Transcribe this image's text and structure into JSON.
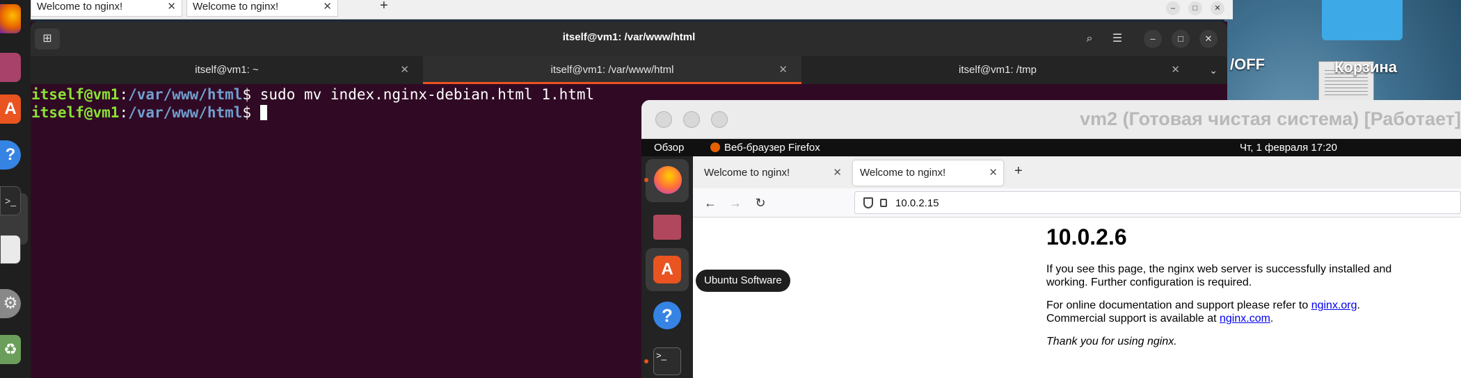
{
  "host_browser": {
    "tabs": [
      {
        "title": "Welcome to nginx!"
      },
      {
        "title": "Welcome to nginx!"
      }
    ],
    "new_tab_label": "+"
  },
  "terminal": {
    "window_title": "itself@vm1: /var/www/html",
    "tabs": [
      {
        "title": "itself@vm1: ~",
        "active": false
      },
      {
        "title": "itself@vm1: /var/www/html",
        "active": true
      },
      {
        "title": "itself@vm1: /tmp",
        "active": false
      }
    ],
    "lines": [
      {
        "user": "itself@vm1",
        "sep": ":",
        "path": "/var/www/html",
        "sym": "$ ",
        "cmd": "sudo mv index.nginx-debian.html 1.html"
      },
      {
        "user": "itself@vm1",
        "sep": ":",
        "path": "/var/www/html",
        "sym": "$ ",
        "cmd": ""
      }
    ]
  },
  "desktop": {
    "labels": [
      "/OFF",
      "Корзина"
    ]
  },
  "vm": {
    "window_title": "vm2 (Готовая чистая система) [Работает]",
    "gnome_bar": {
      "overview": "Обзор",
      "app_name": "Веб-браузер Firefox",
      "clock": "Чт, 1 февраля  17:20"
    },
    "dock_tooltip": "Ubuntu Software",
    "firefox": {
      "tabs": [
        {
          "title": "Welcome to nginx!",
          "active": false
        },
        {
          "title": "Welcome to nginx!",
          "active": true
        }
      ],
      "url": "10.0.2.15"
    },
    "page": {
      "heading": "10.0.2.6",
      "para1": "If you see this page, the nginx web server is successfully installed and working. Further configuration is required.",
      "para2_pre": "For online documentation and support please refer to ",
      "para2_link1": "nginx.org",
      "para2_mid": ".",
      "para2_line2_pre": "Commercial support is available at ",
      "para2_link2": "nginx.com",
      "para2_end": ".",
      "thanks": "Thank you for using nginx."
    }
  },
  "colors": {
    "terminal_bg": "#300a24",
    "prompt_user": "#8ae234",
    "prompt_path": "#729fcf",
    "ubuntu_orange": "#e95420"
  }
}
